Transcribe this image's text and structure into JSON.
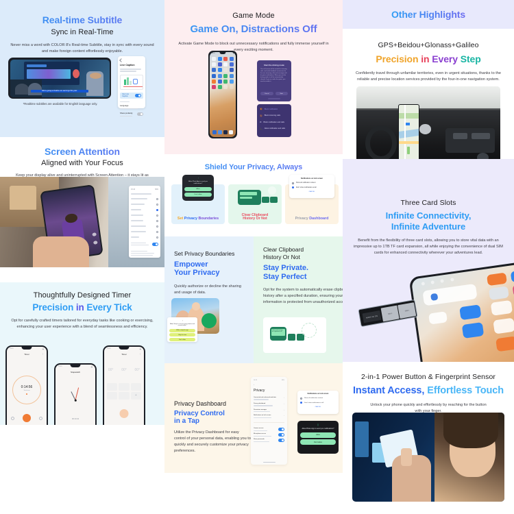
{
  "panels": {
    "realtime_subtitle": {
      "title": "Real-time Subtitle",
      "subtitle": "Sync in Real-Time",
      "body": "Never miss a word with COLOR 8's Real-time Subtitle, stay in sync with every sound and make foreign content effortlessly enjoyable.",
      "footnote": "*Realtime subtitles are available for English language only.",
      "phone_caption": "We're going to finalize our earnings this year.",
      "side_card_title": "Live Caption",
      "side_card_toggle_label": "Use Live Caption",
      "side_card_row1": "Language",
      "side_card_row2": "Show profanity",
      "bg": "#dcebfa"
    },
    "screen_attention": {
      "title": "Screen Attention",
      "subtitle": "Aligned with Your Focus",
      "body": "Keep your display alive and uninterrupted with Screen Attention – it stays lit as long as your attention is on it.",
      "bg": "#ffffff"
    },
    "timer": {
      "title": "Thoughtfully Designed Timer",
      "subtitle": "Precision in Every Tick",
      "subtitle_parts": [
        {
          "text": "Precision ",
          "color": "#2f9df4"
        },
        {
          "text": "in ",
          "color": "#5a5ae8"
        },
        {
          "text": "Every Tick",
          "color": "#2f9df4"
        }
      ],
      "body": "Opt for carefully crafted timers tailored for everyday tasks like cooking or exercising, enhancing your user experience with a blend of seamlessness and efficiency.",
      "timer_value": "0:14:56",
      "timer_sublabel": "Total time",
      "stopwatch_label": "Stopwatch",
      "clock_label": "Timer",
      "world_values": [
        "00°",
        "00°",
        "00°"
      ],
      "bg": "#eaf7fb"
    },
    "game_mode": {
      "title": "Game Mode",
      "subtitle": "Game On, Distractions Off",
      "body": "Activate Game Mode to block out unnecessary notifications and fully immerse yourself in every exciting moment.",
      "dialog_title": "Start the driving mode",
      "dialog_body": "The call screen will be muted for incoming calls, and audio feedback announces for the new incoming calls and messages will be given notifications. When you exit the driving mode, it will be automatically cleared. If you are under the game, you need to enable it.",
      "dialog_cancel": "Cancel",
      "dialog_ok": "Start",
      "menu_items": [
        "Block notification",
        "Block incoming calls",
        "Block notification and calls",
        "Allow notification and calls"
      ],
      "bg": "#fdeef0"
    },
    "privacy_header": {
      "title": "Shield Your Privacy, Always",
      "cards": [
        {
          "label_parts": [
            {
              "text": "Set ",
              "color": "#f5a623"
            },
            {
              "text": "Privacy ",
              "color": "#2f6bf0"
            },
            {
              "text": "Boundaries",
              "color": "#7b4fd8"
            }
          ],
          "popup_text": "Allow Photo App to send you notifications?",
          "btn_allow": "Allow",
          "btn_deny": "Don't allow",
          "bg": "#e2f1fb"
        },
        {
          "label_parts": [
            {
              "text": "Clear Clipboard ",
              "color": "#ea4b5e"
            },
            {
              "text": "History Or Not",
              "color": "#ea4b5e"
            }
          ],
          "bg": "#e4f7ec"
        },
        {
          "label_parts": [
            {
              "text": "Privacy ",
              "color": "#9aa0ad"
            },
            {
              "text": "Dashboard",
              "color": "#6b6bf0"
            }
          ],
          "popup_title": "Notifications on lock screen",
          "popup_opt1": "Show all notification content",
          "popup_opt2": "Don't show notifications at all",
          "popup_link": "CANCEL",
          "bg": "#fdf3e3"
        }
      ],
      "bg": "#ffffff"
    },
    "set_privacy": {
      "title": "Set Privacy Boundaries",
      "subtitle_l1": "Empower",
      "subtitle_l2": "Your Privacy",
      "body": "Quickly authorize or decline the sharing and usage of data.",
      "popup_text": "Allow Snap! to access your photos and records data?",
      "btn1": "While using the app",
      "btn2": "Only this time",
      "btn3": "Don't allow",
      "badge": "Clear to apply now",
      "bg": "#e6f1fb"
    },
    "clear_clipboard": {
      "title_l1": "Clear Clipboard",
      "title_l2": "History Or Not",
      "subtitle_l1": "Stay Private.",
      "subtitle_l2": "Stay Perfect",
      "body": "Opt for the system to automatically erase clipboard history after a specified duration, ensuring your information is protected from unauthorized access.",
      "chip_text": "I don't want to keep the clipboard at all",
      "bg": "#e6f7ec"
    },
    "privacy_dashboard": {
      "title": "Privacy Dashboard",
      "subtitle_l1": "Privacy Control",
      "subtitle_l2": "in a Tap",
      "body": "Utilize the Privacy Dashboard for easy control of your personal data, enabling you to quickly and securely customize your privacy preferences.",
      "screen_title": "Privacy",
      "rows": [
        "Connected and enhanced web data",
        "Privacy dashboard",
        "Permission manager",
        "Notifications on lock screen"
      ],
      "toggle_rows": [
        "Camera access",
        "Microphone access",
        "Show passwords"
      ],
      "popup_title": "Notifications on lock screen",
      "popup_opt1": "Show all notification content",
      "popup_opt2": "Don't show notifications at all",
      "popup_link": "CANCEL",
      "dark_popup_text": "Allow Photo App to send you notifications?",
      "dark_btn_allow": "Allow",
      "dark_btn_deny": "Don't allow",
      "bg": "#fdf6e9"
    },
    "other_highlights": {
      "banner": "Other Highlights",
      "banner_bg": "#e8e9fc",
      "title": "GPS+Beidou+Glonass+Galileo",
      "subtitle_parts": [
        {
          "text": "Precision ",
          "color": "#f0a42a"
        },
        {
          "text": "in ",
          "color": "#e8425c"
        },
        {
          "text": "Every ",
          "color": "#8a3fd0"
        },
        {
          "text": "Step",
          "color": "#18b5a3"
        }
      ],
      "body": "Confidently travel through unfamilar territories, even in urgent situations, thanks to the reliable and precise location services provided by the four-in-one navigation system.",
      "bg": "#ffffff"
    },
    "three_card_slots": {
      "title": "Three Card Slots",
      "subtitle_l1": "Infinite Connectivity,",
      "subtitle_l2": "Infinite Adventure",
      "body": "Benefit from the flexibility of three card slots, allowing you to store vital data with an impressive up to 1TB TF card expansion, all while enjoying the convenience of dual SIM cards for enhanced connectivity wherever your adventures lead.",
      "tray_labels": [
        "MICRO SD 1TB",
        "SIM 1",
        "SIM 2"
      ],
      "bg": "#eceafb"
    },
    "power_button": {
      "title": "2-in-1 Power Button & Fingerprint Sensor",
      "subtitle_parts": [
        {
          "text": "Instant Access, ",
          "color": "#2f6bf0"
        },
        {
          "text": "Effortless Touch",
          "color": "#49b6f7"
        }
      ],
      "body": "Unlock your phone quickly and effortlessly by reaching for the button with your finger.",
      "bg": "#ffffff"
    }
  }
}
